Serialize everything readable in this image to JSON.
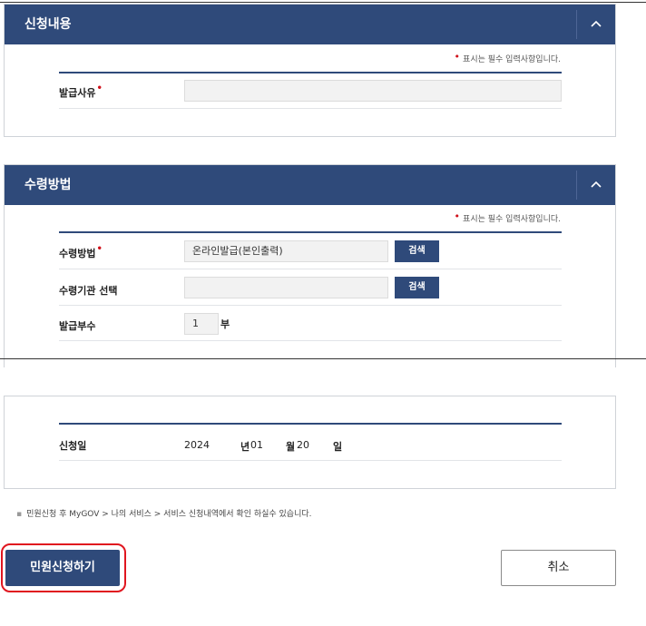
{
  "section_application": {
    "title": "신청내용",
    "required_note": "표시는 필수 입력사항입니다.",
    "issue_reason": {
      "label": "발급사유",
      "value": ""
    }
  },
  "section_receipt": {
    "title": "수령방법",
    "required_note": "표시는 필수 입력사항입니다.",
    "receipt_method": {
      "label": "수령방법",
      "value": "온라인발급(본인출력)",
      "search_label": "검색"
    },
    "receipt_agency": {
      "label": "수령기관 선택",
      "value": "",
      "search_label": "검색"
    },
    "copies": {
      "label": "발급부수",
      "value": "1",
      "unit": "부"
    }
  },
  "section_date": {
    "label": "신청일",
    "year": "2024",
    "year_unit": "년",
    "month": "01",
    "month_unit": "월",
    "day": "20",
    "day_unit": "일"
  },
  "footnote": "민원신청 후 MyGOV > 나의 서비스 > 서비스 신청내역에서 확인 하실수 있습니다.",
  "actions": {
    "submit_label": "민원신청하기",
    "cancel_label": "취소"
  },
  "icons": {
    "collapse": "chevron-up-icon"
  },
  "colors": {
    "primary": "#2f4a7a",
    "required": "#d0111b",
    "highlight": "#e0161f"
  }
}
